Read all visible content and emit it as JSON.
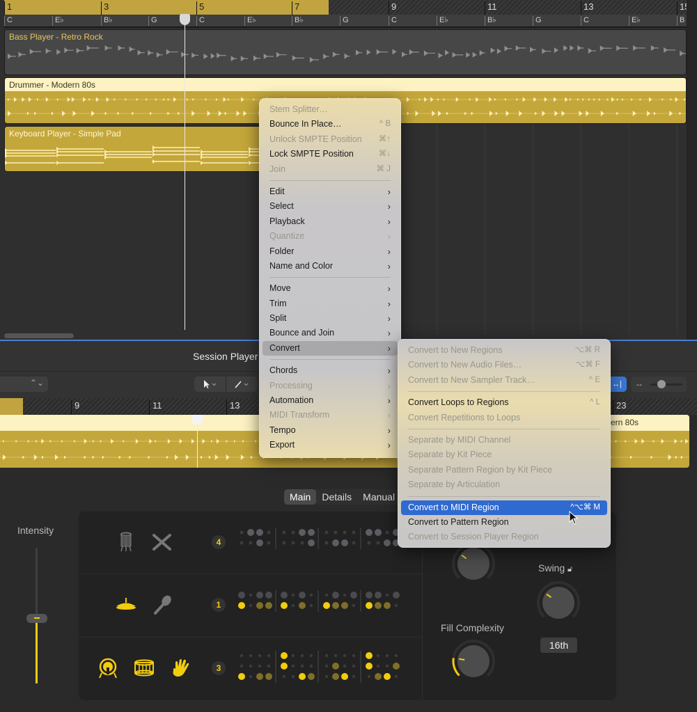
{
  "arrange": {
    "bar_numbers": [
      "1",
      "3",
      "5",
      "7",
      "9",
      "11",
      "13",
      "15"
    ],
    "chords": [
      "C",
      "E♭",
      "B♭",
      "G",
      "C",
      "E♭",
      "B♭",
      "G",
      "C",
      "E♭",
      "B♭",
      "G",
      "C",
      "E♭",
      "B"
    ],
    "regions": [
      {
        "name": "Bass Player - Retro Rock",
        "color": "#474747",
        "title_color": "#e7c55a"
      },
      {
        "name": "Drummer - Modern 80s",
        "color": "#c4a73a",
        "header_color": "#fdf2c2"
      },
      {
        "name": "Keyboard Player - Simple Pad",
        "color": "#c4a73a"
      }
    ]
  },
  "editor": {
    "title": "Session Player",
    "pointer_tool": "pointer",
    "pencil_tool": "pencil",
    "bar_numbers": [
      "9",
      "11",
      "13",
      "23"
    ],
    "region_name_fragment": "ern 80s",
    "tabs": [
      {
        "label": "Main",
        "active": true
      },
      {
        "label": "Details",
        "active": false
      },
      {
        "label": "Manual",
        "active": false
      }
    ],
    "intensity": {
      "label": "Intensity",
      "value": 0.48
    },
    "kit_rows": [
      {
        "badge": "4",
        "icons": [
          "hi-hat-icon",
          "sticks-icon"
        ],
        "icon_active": [
          false,
          false
        ]
      },
      {
        "badge": "1",
        "icons": [
          "cymbal-icon",
          "shaker-icon"
        ],
        "icon_active": [
          true,
          false
        ]
      },
      {
        "badge": "3",
        "icons": [
          "kick-drum-icon",
          "snare-drum-icon",
          "hand-clap-icon"
        ],
        "icon_active": [
          true,
          true,
          true
        ]
      }
    ],
    "knobs": [
      {
        "label": "",
        "value": 0.3
      },
      {
        "label": "Swing",
        "value": 0.3,
        "locked": false
      },
      {
        "label": "Fill Complexity",
        "value": 0.2
      }
    ],
    "swing_resolution": "16th",
    "accent_color": "#f2cc0f"
  },
  "context_menu": {
    "items": [
      {
        "label": "Stem Splitter…",
        "shortcut": "",
        "disabled": true
      },
      {
        "label": "Bounce In Place…",
        "shortcut": "^ B",
        "disabled": false
      },
      {
        "label": "Unlock SMPTE Position",
        "shortcut": "⌘↑",
        "disabled": true
      },
      {
        "label": "Lock SMPTE Position",
        "shortcut": "⌘↓",
        "disabled": false
      },
      {
        "label": "Join",
        "shortcut": "⌘ J",
        "disabled": true
      },
      {
        "separator": true
      },
      {
        "label": "Edit",
        "submenu": true,
        "disabled": false
      },
      {
        "label": "Select",
        "submenu": true,
        "disabled": false
      },
      {
        "label": "Playback",
        "submenu": true,
        "disabled": false
      },
      {
        "label": "Quantize",
        "submenu": true,
        "disabled": true
      },
      {
        "label": "Folder",
        "submenu": true,
        "disabled": false
      },
      {
        "label": "Name and Color",
        "submenu": true,
        "disabled": false
      },
      {
        "separator": true
      },
      {
        "label": "Move",
        "submenu": true,
        "disabled": false
      },
      {
        "label": "Trim",
        "submenu": true,
        "disabled": false
      },
      {
        "label": "Split",
        "submenu": true,
        "disabled": false
      },
      {
        "label": "Bounce and Join",
        "submenu": true,
        "disabled": false
      },
      {
        "label": "Convert",
        "submenu": true,
        "disabled": false,
        "open": true
      },
      {
        "separator": true
      },
      {
        "label": "Chords",
        "submenu": true,
        "disabled": false
      },
      {
        "label": "Processing",
        "submenu": true,
        "disabled": true
      },
      {
        "label": "Automation",
        "submenu": true,
        "disabled": false
      },
      {
        "label": "MIDI Transform",
        "submenu": true,
        "disabled": true
      },
      {
        "label": "Tempo",
        "submenu": true,
        "disabled": false
      },
      {
        "label": "Export",
        "submenu": true,
        "disabled": false
      }
    ]
  },
  "convert_submenu": {
    "items": [
      {
        "label": "Convert to New Regions",
        "shortcut": "⌥⌘ R",
        "disabled": true
      },
      {
        "label": "Convert to New Audio Files…",
        "shortcut": "⌥⌘ F",
        "disabled": true
      },
      {
        "label": "Convert to New Sampler Track…",
        "shortcut": "^ E",
        "disabled": true
      },
      {
        "separator": true
      },
      {
        "label": "Convert Loops to Regions",
        "shortcut": "^ L",
        "disabled": false
      },
      {
        "label": "Convert Repetitions to Loops",
        "shortcut": "",
        "disabled": true
      },
      {
        "separator": true
      },
      {
        "label": "Separate by MIDI Channel",
        "shortcut": "",
        "disabled": true
      },
      {
        "label": "Separate by Kit Piece",
        "shortcut": "",
        "disabled": true
      },
      {
        "label": "Separate Pattern Region by Kit Piece",
        "shortcut": "",
        "disabled": true
      },
      {
        "label": "Separate by Articulation",
        "shortcut": "",
        "disabled": true
      },
      {
        "separator": true
      },
      {
        "label": "Convert to MIDI Region",
        "shortcut": "^⌥⌘ M",
        "disabled": false,
        "selected": true
      },
      {
        "label": "Convert to Pattern Region",
        "shortcut": "",
        "disabled": false
      },
      {
        "label": "Convert to Session Player Region",
        "shortcut": "",
        "disabled": true
      }
    ]
  }
}
